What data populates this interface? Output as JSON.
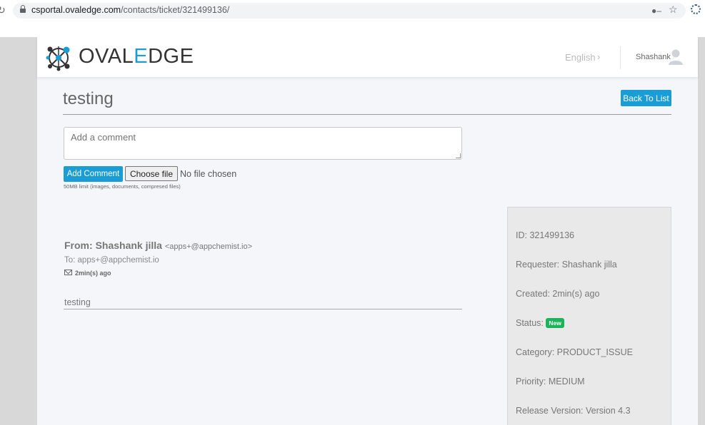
{
  "browser": {
    "url_host": "csportal.ovaledge.com",
    "url_path": "/contacts/ticket/321499136/"
  },
  "header": {
    "brand_pre": "OVAL",
    "brand_e": "E",
    "brand_post": "DGE",
    "language": "English",
    "username": "Shashank"
  },
  "ticket": {
    "title": "testing",
    "back_button": "Back To List"
  },
  "comment_form": {
    "placeholder": "Add a comment",
    "add_button": "Add Comment",
    "choose_file": "Choose file",
    "no_file": "No file chosen",
    "limit_note": "50MB limit (images, documents, compresed files)"
  },
  "message": {
    "from_label": "From:",
    "from_name": "Shashank jilla",
    "from_email": "<apps+@appchemist.io>",
    "to_line": "To: apps+@appchemist.io",
    "time": "2min(s) ago",
    "body": "testing"
  },
  "details": {
    "id": "ID: 321499136",
    "requester": "Requester: Shashank jilla",
    "created": "Created: 2min(s) ago",
    "status_label": "Status:",
    "status_badge": "New",
    "category": "Category: PRODUCT_ISSUE",
    "priority": "Priority: MEDIUM",
    "release": "Release Version: Version 4.3"
  },
  "colors": {
    "accent": "#1a9dd4",
    "status_new": "#1bb45a"
  }
}
